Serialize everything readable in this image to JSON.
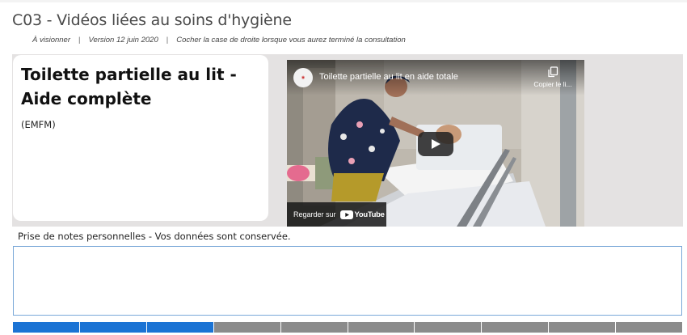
{
  "page": {
    "title": "C03 - Vidéos liées au soins d'hygiène",
    "meta": {
      "status": "À visionner",
      "separator": "|",
      "version": "Version 12 juin 2020",
      "instruction": "Cocher la case de droite lorsque vous aurez terminé la consultation"
    }
  },
  "card": {
    "title": "Toilette partielle au lit - Aide complète",
    "source": "(EMFM)"
  },
  "video": {
    "title": "Toilette partielle au lit en aide totale",
    "copy_label": "Copier le li...",
    "watch_on_label": "Regarder sur",
    "youtube_label": "YouTube",
    "channel_icon": "channel-avatar",
    "play_icon": "play-icon",
    "copy_icon": "copy-icon"
  },
  "notes": {
    "label": "Prise de notes personnelles - Vos données sont conservée.",
    "value": "",
    "placeholder": ""
  },
  "progress": {
    "total_steps": 10,
    "completed_steps": 3,
    "colors": {
      "done": "#1b73d4",
      "todo": "#8b8b8b"
    }
  },
  "colors": {
    "accent": "#1b73d4",
    "panel": "#e4e2e2",
    "notes_border": "#7aa8d8"
  }
}
